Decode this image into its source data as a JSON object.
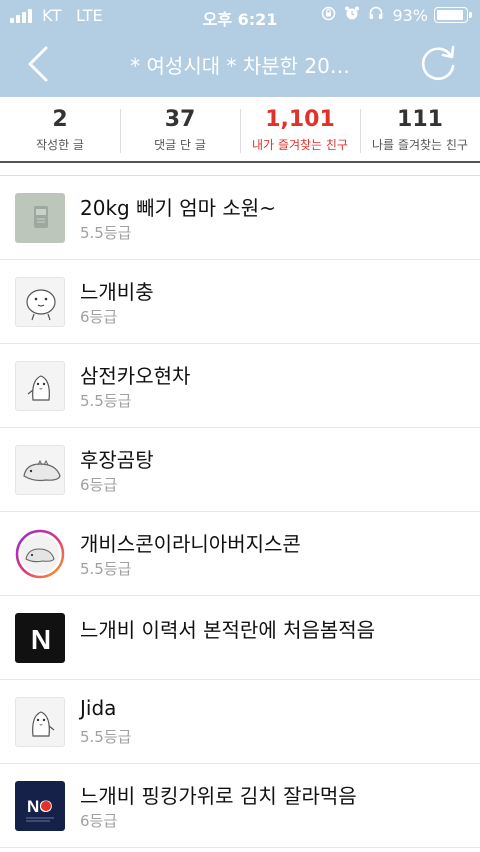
{
  "status_bar": {
    "carrier": "KT",
    "network": "LTE",
    "time": "오후 6:21",
    "battery": "93%",
    "battery_level": 0.93,
    "icons": [
      "orientation-lock-icon",
      "alarm-icon",
      "headphones-icon",
      "battery-icon"
    ]
  },
  "nav": {
    "title": "* 여성시대 *  차분한 20…",
    "back_icon": "chevron-left-icon",
    "refresh_icon": "refresh-icon"
  },
  "stats": [
    {
      "value": "2",
      "label": "작성한 글",
      "active": false
    },
    {
      "value": "37",
      "label": "댓글 단 글",
      "active": false
    },
    {
      "value": "1,101",
      "label": "내가 즐겨찾는 친구",
      "active": true
    },
    {
      "value": "111",
      "label": "나를 즐겨찾는 친구",
      "active": false
    }
  ],
  "accent_color": "#e0322b",
  "header_color": "#b3cde2",
  "friends": [
    {
      "name": "20kg 빼기 엄마 소원~",
      "grade": "5.5등급",
      "avatar": "scale-photo"
    },
    {
      "name": "느개비충",
      "grade": "6등급",
      "avatar": "round-creature"
    },
    {
      "name": "삼전카오현차",
      "grade": "5.5등급",
      "avatar": "penguin"
    },
    {
      "name": "후장곰탕",
      "grade": "6등급",
      "avatar": "lizard"
    },
    {
      "name": "개비스콘이라니아버지스콘",
      "grade": "5.5등급",
      "avatar": "lizard-ring"
    },
    {
      "name": "느개비 이력서 본적란에 처음봄적음",
      "grade": "",
      "avatar": "letter-n"
    },
    {
      "name": "Jida",
      "grade": "5.5등급",
      "avatar": "penguin"
    },
    {
      "name": "느개비 핑킹가위로 김치 잘라먹음",
      "grade": "6등급",
      "avatar": "no-poster"
    }
  ],
  "avatar_text": {
    "letter_n": "N",
    "no_poster": "NO"
  }
}
